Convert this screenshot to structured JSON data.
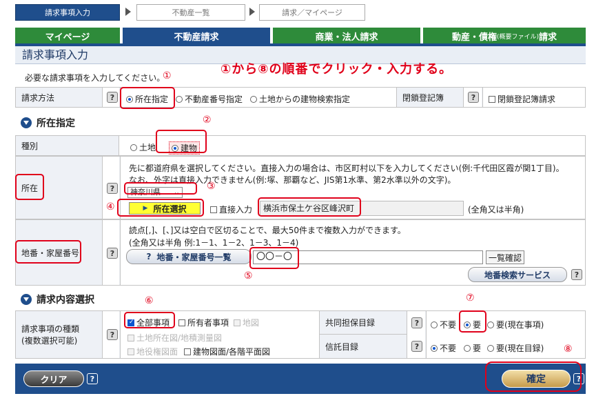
{
  "steps": [
    "請求事項入力",
    "不動産一覧",
    "請求／マイページ"
  ],
  "tabs": {
    "mypage": "マイページ",
    "fudosan": "不動産請求",
    "shogyo": "商業・法人請求",
    "dosan_main": "動産・債権",
    "dosan_small": "(概要ファイル)",
    "dosan_tail": "請求"
  },
  "page_title": "請求事項入力",
  "instruction": "①から⑧の順番でクリック・入力する。",
  "note": "必要な請求事項を入力してください。",
  "markers": [
    "①",
    "②",
    "③",
    "④",
    "⑤",
    "⑥",
    "⑦",
    "⑧"
  ],
  "method": {
    "label": "請求方法",
    "options": [
      "所在指定",
      "不動産番号指定",
      "土地からの建物検索指定"
    ],
    "closed_label": "閉鎖登記簿",
    "closed_checkbox": "閉鎖登記簿請求"
  },
  "section_location": "所在指定",
  "type": {
    "label": "種別",
    "options": [
      "土地",
      "建物"
    ]
  },
  "location": {
    "label": "所在",
    "line1": "先に都道府県を選択してください。直接入力の場合は、市区町村以下を入力してください(例:千代田区霞が関1丁目)。",
    "line2": "なお、外字は直接入力できません(例:塚、那覇など、JIS第1水準、第2水準以外の文字)。",
    "prefecture": "神奈川県",
    "select_button": "所在選択",
    "direct_input": "直接入力",
    "address_value": "横浜市保土ケ谷区峰沢町",
    "width_note": "(全角又は半角)"
  },
  "chiban": {
    "label_a": "地番・",
    "label_b": "家屋番号",
    "line1": "読点[,]、[、]又は空白で区切ることで、最大50件まで複数入力ができます。",
    "line2": "(全角又は半角  例:1－1、1－2、1－3、1－4)",
    "list_button": "地番・家屋番号一覧",
    "list_button_icon": "?",
    "value": "〇〇－〇",
    "confirm_button": "一覧確認",
    "search_service": "地番検索サービス"
  },
  "section_request": "請求内容選択",
  "request_types": {
    "label_a": "請求事項の種類",
    "label_b": "(複数選択可能)",
    "all": "全部事項",
    "owner": "所有者事項",
    "map": "地図",
    "land_map": "土地所在図/地積測量図",
    "chieki": "地役権図面",
    "building_plan": "建物図面/各階平面図"
  },
  "kyodo": {
    "label": "共同担保目録",
    "options": [
      "不要",
      "要",
      "要(現在事項)"
    ]
  },
  "shintaku": {
    "label": "信託目録",
    "options": [
      "不要",
      "要",
      "要(現在目録)"
    ]
  },
  "footer": {
    "clear": "クリア",
    "confirm": "確定",
    "help": "?"
  },
  "help_mark": "?",
  "colors": {
    "navy": "#1f4e8c",
    "green": "#2e8b3a",
    "marker_red": "#e0001a",
    "confirm_gold": "#d9b36a"
  }
}
